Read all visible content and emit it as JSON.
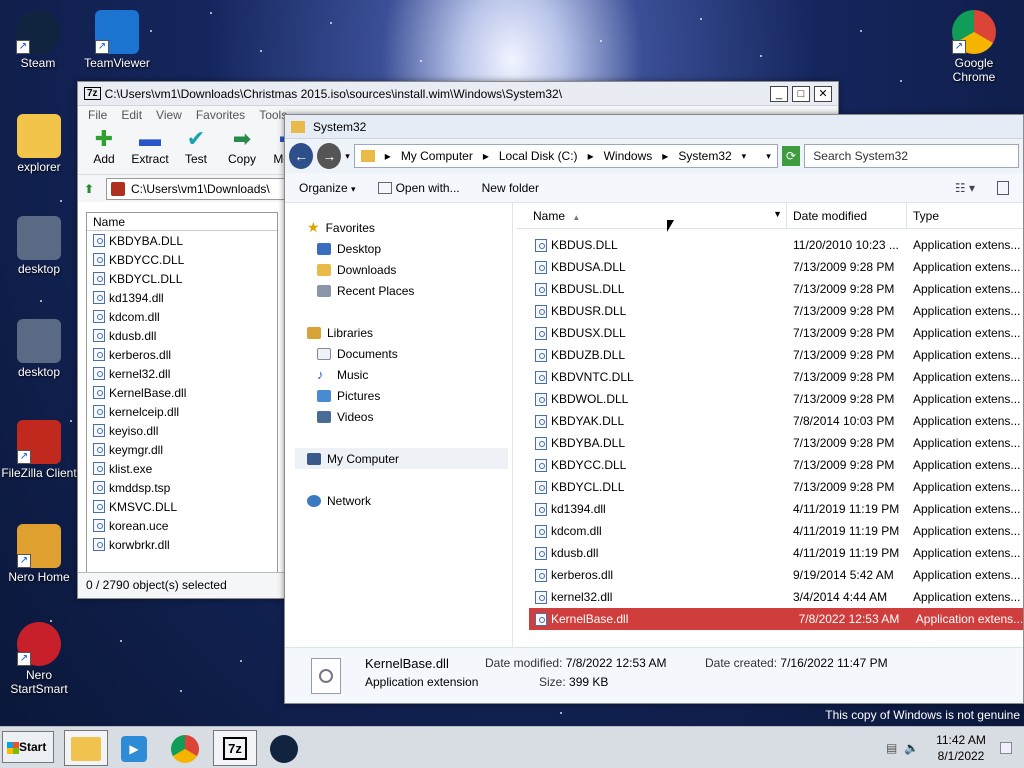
{
  "desktop_icons": [
    {
      "label": "Steam"
    },
    {
      "label": "TeamViewer"
    },
    {
      "label": "Google Chrome"
    },
    {
      "label": "explorer"
    },
    {
      "label": "desktop"
    },
    {
      "label": "desktop"
    },
    {
      "label": "FileZilla Client"
    },
    {
      "label": "Nero Home"
    },
    {
      "label": "Nero StartSmart"
    }
  ],
  "sevenzip": {
    "title": "C:\\Users\\vm1\\Downloads\\Christmas 2015.iso\\sources\\install.wim\\Windows\\System32\\",
    "menu": [
      "File",
      "Edit",
      "View",
      "Favorites",
      "Tools"
    ],
    "tools": [
      {
        "label": "Add",
        "icon": "plus-icon"
      },
      {
        "label": "Extract",
        "icon": "minus-icon"
      },
      {
        "label": "Test",
        "icon": "check-icon"
      },
      {
        "label": "Copy",
        "icon": "copy-arrow-icon"
      },
      {
        "label": "Move",
        "icon": "move-arrow-icon"
      }
    ],
    "address": "C:\\Users\\vm1\\Downloads\\",
    "column_name": "Name",
    "files": [
      "KBDYBA.DLL",
      "KBDYCC.DLL",
      "KBDYCL.DLL",
      "kd1394.dll",
      "kdcom.dll",
      "kdusb.dll",
      "kerberos.dll",
      "kernel32.dll",
      "KernelBase.dll",
      "kernelceip.dll",
      "keyiso.dll",
      "keymgr.dll",
      "klist.exe",
      "kmddsp.tsp",
      "KMSVC.DLL",
      "korean.uce",
      "korwbrkr.dll"
    ],
    "status": "0 / 2790 object(s) selected"
  },
  "explorer": {
    "title": "System32",
    "breadcrumbs": [
      "My Computer",
      "Local Disk (C:)",
      "Windows",
      "System32"
    ],
    "search_placeholder": "Search System32",
    "commands": [
      "Organize",
      "Open with...",
      "New folder"
    ],
    "nav": {
      "favorites": "Favorites",
      "favorite_items": [
        "Desktop",
        "Downloads",
        "Recent Places"
      ],
      "libraries": "Libraries",
      "library_items": [
        "Documents",
        "Music",
        "Pictures",
        "Videos"
      ],
      "computer": "My Computer",
      "network": "Network"
    },
    "columns": {
      "name": "Name",
      "date": "Date modified",
      "type": "Type"
    },
    "files": [
      {
        "name": "KBDUS.DLL",
        "date": "11/20/2010 10:23 ...",
        "type": "Application extens..."
      },
      {
        "name": "KBDUSA.DLL",
        "date": "7/13/2009 9:28 PM",
        "type": "Application extens..."
      },
      {
        "name": "KBDUSL.DLL",
        "date": "7/13/2009 9:28 PM",
        "type": "Application extens..."
      },
      {
        "name": "KBDUSR.DLL",
        "date": "7/13/2009 9:28 PM",
        "type": "Application extens..."
      },
      {
        "name": "KBDUSX.DLL",
        "date": "7/13/2009 9:28 PM",
        "type": "Application extens..."
      },
      {
        "name": "KBDUZB.DLL",
        "date": "7/13/2009 9:28 PM",
        "type": "Application extens..."
      },
      {
        "name": "KBDVNTC.DLL",
        "date": "7/13/2009 9:28 PM",
        "type": "Application extens..."
      },
      {
        "name": "KBDWOL.DLL",
        "date": "7/13/2009 9:28 PM",
        "type": "Application extens..."
      },
      {
        "name": "KBDYAK.DLL",
        "date": "7/8/2014 10:03 PM",
        "type": "Application extens..."
      },
      {
        "name": "KBDYBA.DLL",
        "date": "7/13/2009 9:28 PM",
        "type": "Application extens..."
      },
      {
        "name": "KBDYCC.DLL",
        "date": "7/13/2009 9:28 PM",
        "type": "Application extens..."
      },
      {
        "name": "KBDYCL.DLL",
        "date": "7/13/2009 9:28 PM",
        "type": "Application extens..."
      },
      {
        "name": "kd1394.dll",
        "date": "4/11/2019 11:19 PM",
        "type": "Application extens..."
      },
      {
        "name": "kdcom.dll",
        "date": "4/11/2019 11:19 PM",
        "type": "Application extens..."
      },
      {
        "name": "kdusb.dll",
        "date": "4/11/2019 11:19 PM",
        "type": "Application extens..."
      },
      {
        "name": "kerberos.dll",
        "date": "9/19/2014 5:42 AM",
        "type": "Application extens..."
      },
      {
        "name": "kernel32.dll",
        "date": "3/4/2014 4:44 AM",
        "type": "Application extens..."
      },
      {
        "name": "KernelBase.dll",
        "date": "7/8/2022 12:53 AM",
        "type": "Application extens..."
      }
    ],
    "details": {
      "name": "KernelBase.dll",
      "kind": "Application extension",
      "modified_label": "Date modified:",
      "modified": "7/8/2022 12:53 AM",
      "created_label": "Date created:",
      "created": "7/16/2022 11:47 PM",
      "size_label": "Size:",
      "size": "399 KB"
    }
  },
  "watermark": "This copy of Windows is not genuine",
  "taskbar": {
    "start": "Start",
    "time": "11:42 AM",
    "date": "8/1/2022"
  }
}
